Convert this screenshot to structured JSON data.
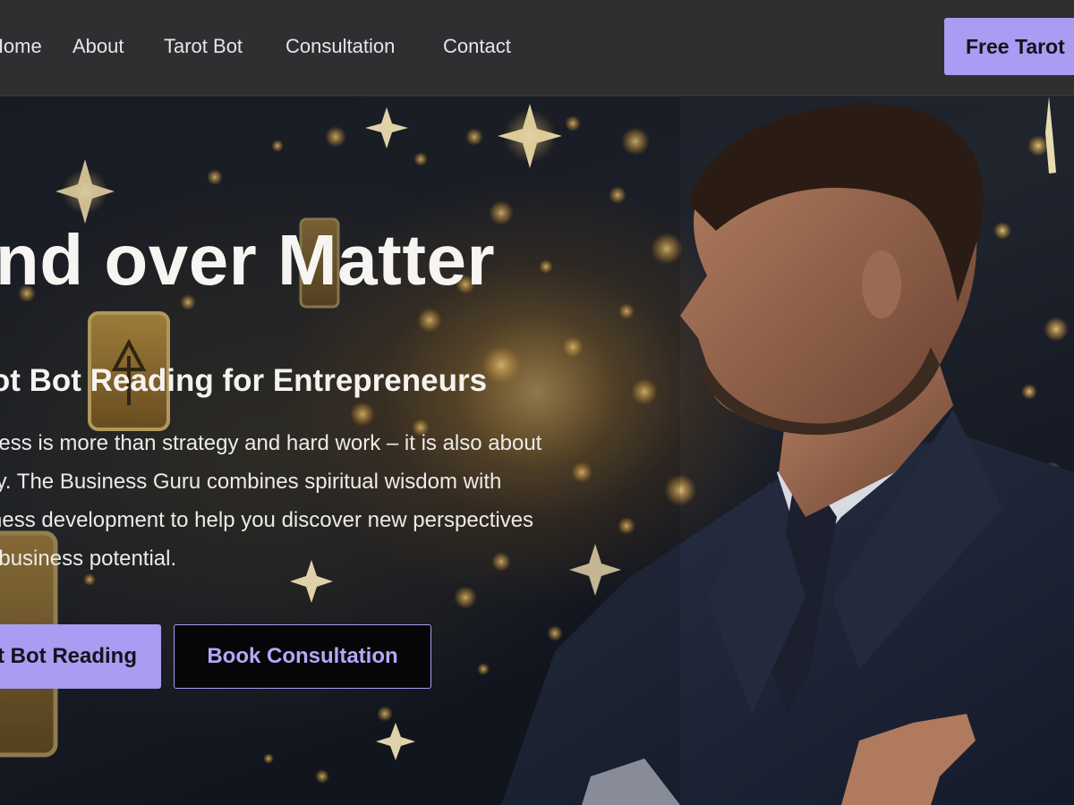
{
  "nav": {
    "links": [
      {
        "label": "Home"
      },
      {
        "label": "About"
      },
      {
        "label": "Tarot Bot"
      },
      {
        "label": "Consultation"
      },
      {
        "label": "Contact"
      }
    ],
    "cta_label": "Free Tarot"
  },
  "hero": {
    "title": "Mind over Matter",
    "subtitle": "Tarot Bot Reading for Entrepreneurs",
    "body_lines": [
      "Success is more than strategy and hard work – it is also about",
      "clarity. The Business Guru combines spiritual wisdom with",
      "business development to help you discover new perspectives",
      "your business potential."
    ],
    "primary_button": "Tarot Bot Reading",
    "secondary_button": "Book Consultation"
  },
  "colors": {
    "accent": "#a99cf3",
    "nav_bg": "#2f2f31",
    "hero_bg": "#1b1f28",
    "glow": "#d69c3a"
  }
}
